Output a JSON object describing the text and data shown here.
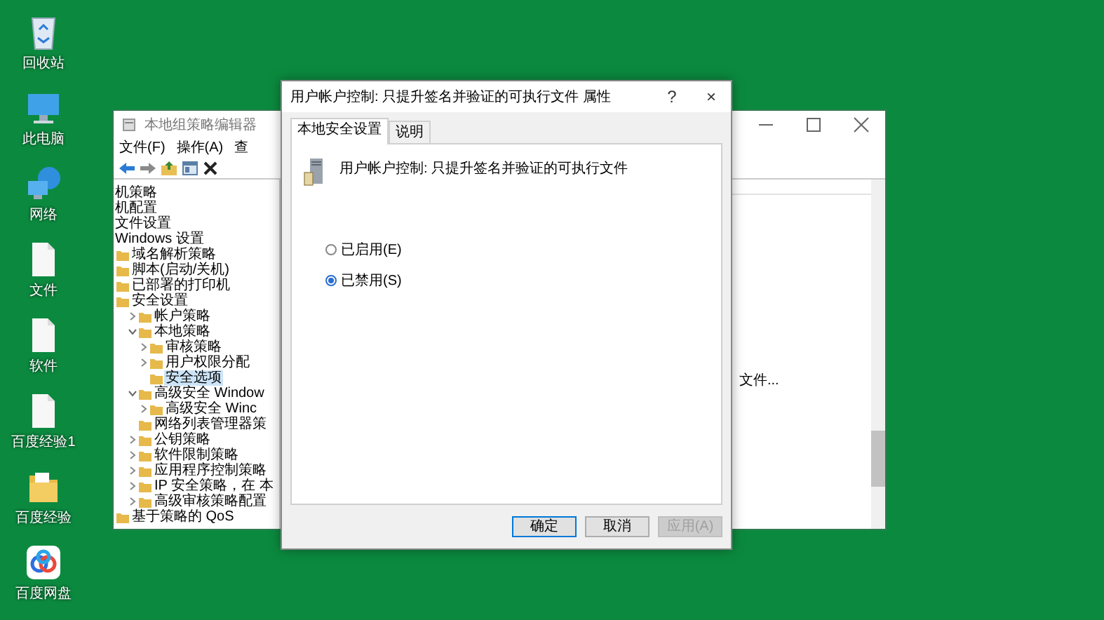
{
  "desktop": {
    "icons": [
      {
        "kind": "bin",
        "label": "回收站"
      },
      {
        "kind": "computer",
        "label": "此电脑"
      },
      {
        "kind": "network",
        "label": "网络"
      },
      {
        "kind": "file",
        "label": "文件"
      },
      {
        "kind": "file",
        "label": "软件"
      },
      {
        "kind": "file",
        "label": "百度经验1"
      },
      {
        "kind": "folder",
        "label": "百度经验"
      },
      {
        "kind": "app",
        "label": "百度网盘"
      }
    ]
  },
  "editor_window": {
    "title": "本地组策略编辑器",
    "menu": [
      "文件(F)",
      "操作(A)",
      "查"
    ],
    "tree": [
      {
        "label": "机策略",
        "selected": false
      },
      {
        "label": "机配置",
        "selected": false
      },
      {
        "label": "文件设置",
        "selected": false
      },
      {
        "label": "Windows 设置",
        "selected": false,
        "children": [
          {
            "label": "域名解析策略",
            "selected": false
          },
          {
            "label": "脚本(启动/关机)",
            "selected": false
          },
          {
            "label": "已部署的打印机",
            "selected": false
          },
          {
            "label": "安全设置",
            "selected": false,
            "children": [
              {
                "label": "帐户策略",
                "selected": false,
                "expanded": false
              },
              {
                "label": "本地策略",
                "selected": false,
                "expanded": true,
                "children": [
                  {
                    "label": "审核策略",
                    "selected": false,
                    "expanded": false
                  },
                  {
                    "label": "用户权限分配",
                    "selected": false,
                    "expanded": false
                  },
                  {
                    "label": "安全选项",
                    "selected": true
                  }
                ]
              },
              {
                "label": "高级安全 Window",
                "selected": false,
                "expanded": true,
                "children": [
                  {
                    "label": "高级安全 Winc",
                    "selected": false,
                    "expanded": false
                  }
                ]
              },
              {
                "label": "网络列表管理器策",
                "selected": false
              },
              {
                "label": "公钥策略",
                "selected": false,
                "expanded": false
              },
              {
                "label": "软件限制策略",
                "selected": false,
                "expanded": false
              },
              {
                "label": "应用程序控制策略",
                "selected": false,
                "expanded": false
              },
              {
                "label": "IP 安全策略，在 本",
                "selected": false,
                "expanded": false
              },
              {
                "label": "高级审核策略配置",
                "selected": false,
                "expanded": false
              }
            ]
          },
          {
            "label": "基于策略的 QoS",
            "selected": false
          }
        ]
      }
    ],
    "list_text": "文件..."
  },
  "dialog": {
    "title": "用户帐户控制: 只提升签名并验证的可执行文件 属性",
    "help": "?",
    "close": "×",
    "tabs": [
      {
        "label": "本地安全设置",
        "selected": true
      },
      {
        "label": "说明",
        "selected": false
      }
    ],
    "policy_name": "用户帐户控制: 只提升签名并验证的可执行文件",
    "options": [
      {
        "label": "已启用(E)",
        "selected": false
      },
      {
        "label": "已禁用(S)",
        "selected": true
      }
    ],
    "buttons": [
      {
        "label": "确定",
        "kind": "default",
        "disabled": false
      },
      {
        "label": "取消",
        "kind": "normal",
        "disabled": false
      },
      {
        "label": "应用(A)",
        "kind": "normal",
        "disabled": true
      }
    ]
  }
}
